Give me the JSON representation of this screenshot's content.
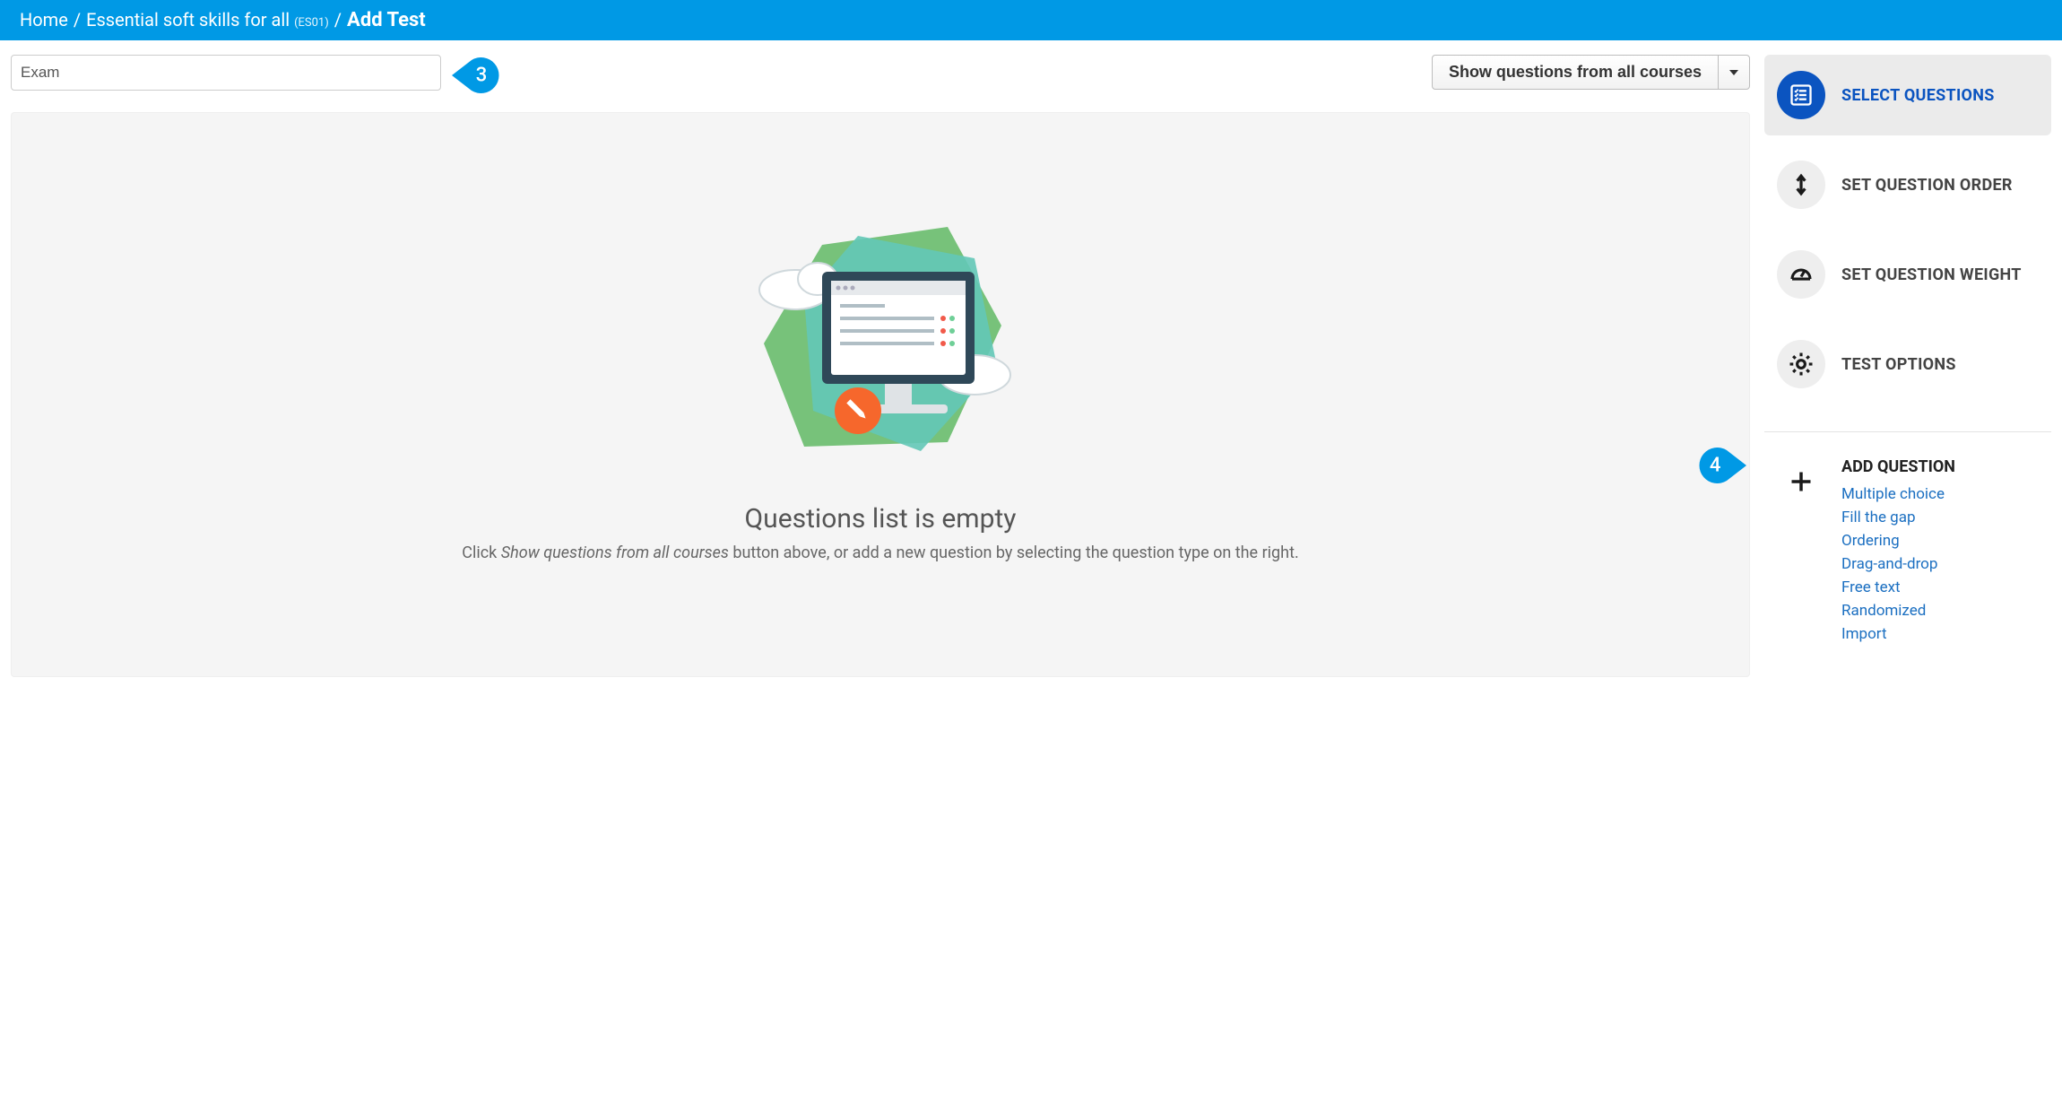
{
  "breadcrumb": {
    "home": "Home",
    "course": "Essential soft skills for all",
    "course_code": "(ES01)",
    "current": "Add Test",
    "sep": " / "
  },
  "form": {
    "test_name_value": "Exam",
    "test_name_placeholder": ""
  },
  "course_filter": {
    "label": "Show questions from all courses"
  },
  "empty_state": {
    "title": "Questions list is empty",
    "desc_pre": "Click ",
    "desc_em": "Show questions from all courses",
    "desc_post": " button above, or add a new question by selecting the question type on the right."
  },
  "sidebar": {
    "items": [
      {
        "label": "SELECT QUESTIONS"
      },
      {
        "label": "SET QUESTION ORDER"
      },
      {
        "label": "SET QUESTION WEIGHT"
      },
      {
        "label": "TEST OPTIONS"
      }
    ],
    "add": {
      "title": "ADD QUESTION",
      "links": [
        "Multiple choice",
        "Fill the gap",
        "Ordering",
        "Drag-and-drop",
        "Free text",
        "Randomized",
        "Import"
      ]
    }
  },
  "callouts": {
    "three": "3",
    "four": "4"
  }
}
